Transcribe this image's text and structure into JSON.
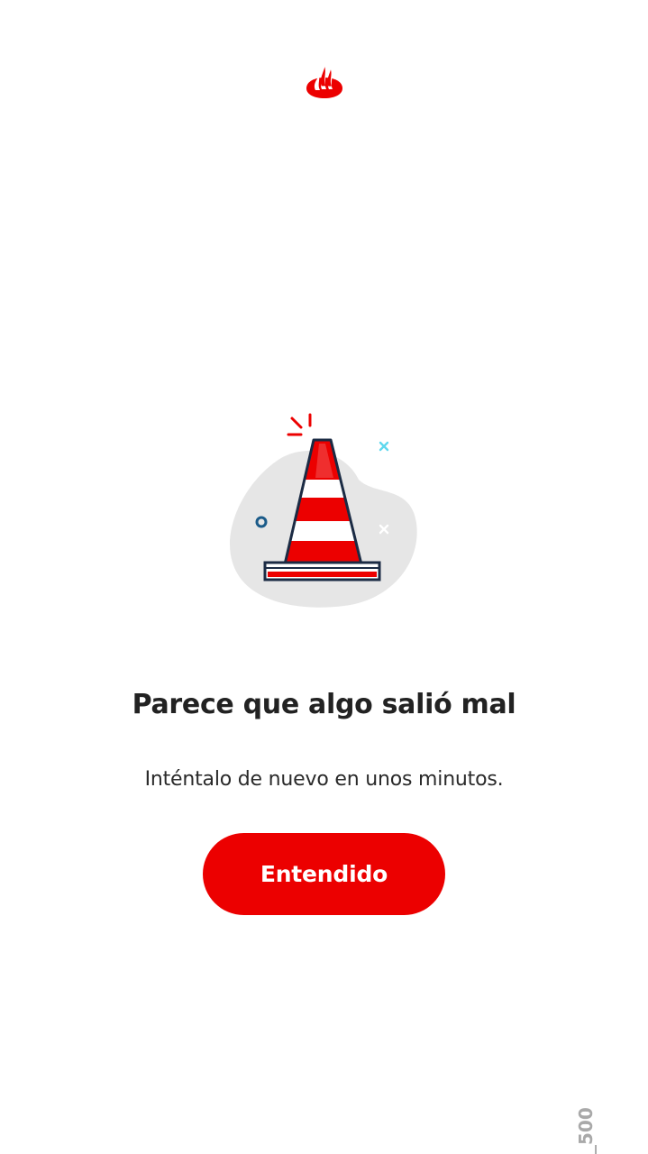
{
  "app": {
    "brand_icon": "santander-flame-icon",
    "brand_color": "#ec0000"
  },
  "illustration": {
    "icon": "traffic-cone-icon",
    "cone_color": "#ec0000",
    "outline_color": "#1b2b44",
    "blob_color": "#e6e6e6",
    "accent_cyan": "#5fd8ee"
  },
  "error": {
    "title": "Parece que algo salió mal",
    "message": "Inténtalo de nuevo en unos minutos.",
    "code_label": "_500"
  },
  "actions": {
    "primary_label": "Entendido"
  }
}
